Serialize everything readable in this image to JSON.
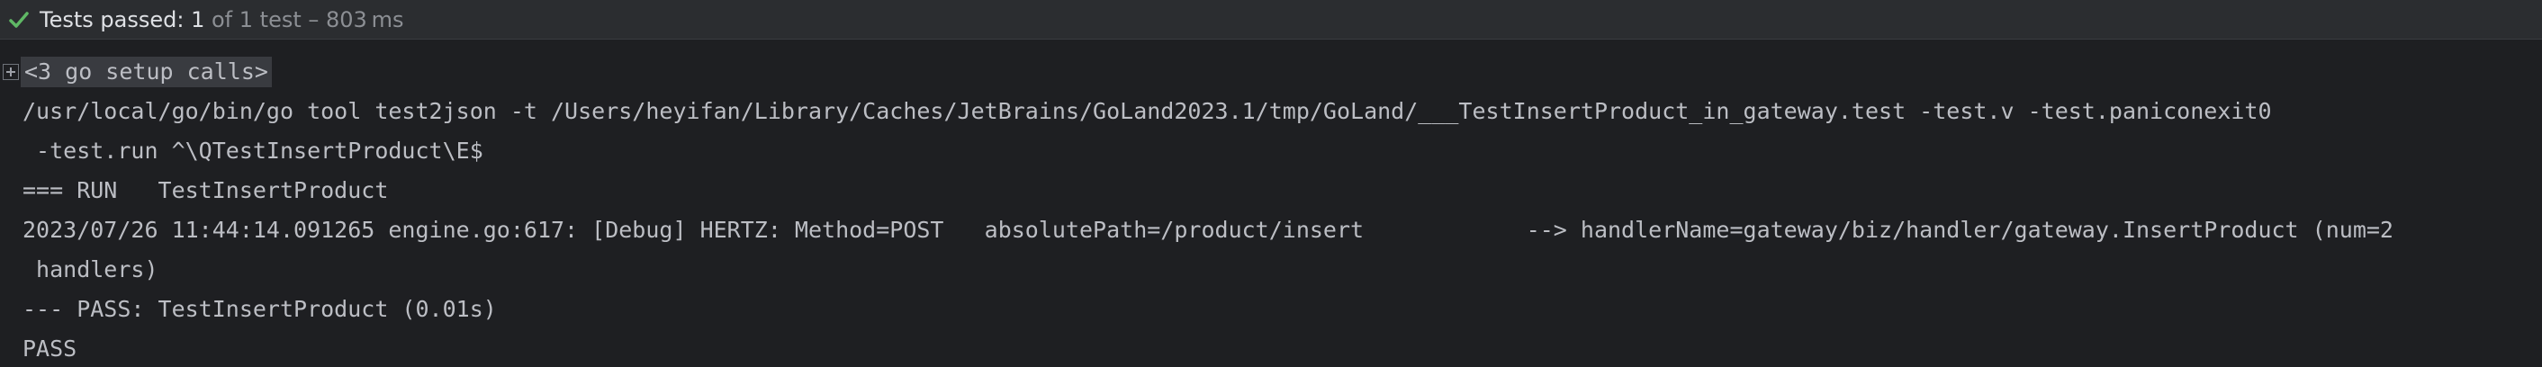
{
  "status": {
    "passed_label": "Tests passed:",
    "count": "1",
    "detail": "of 1 test – 803 ms",
    "accent_color": "#5fb865",
    "icon": "check-icon"
  },
  "console": {
    "fold_label": "<3 go setup calls>",
    "fold_icon": "plus-box-icon",
    "lines": [
      "/usr/local/go/bin/go tool test2json -t /Users/heyifan/Library/Caches/JetBrains/GoLand2023.1/tmp/GoLand/___TestInsertProduct_in_gateway.test -test.v -test.paniconexit0",
      " -test.run ^\\QTestInsertProduct\\E$",
      "=== RUN   TestInsertProduct",
      "2023/07/26 11:44:14.091265 engine.go:617: [Debug] HERTZ: Method=POST   absolutePath=/product/insert            --> handlerName=gateway/biz/handler/gateway.InsertProduct (num=2",
      " handlers)",
      "--- PASS: TestInsertProduct (0.01s)",
      "PASS"
    ]
  }
}
